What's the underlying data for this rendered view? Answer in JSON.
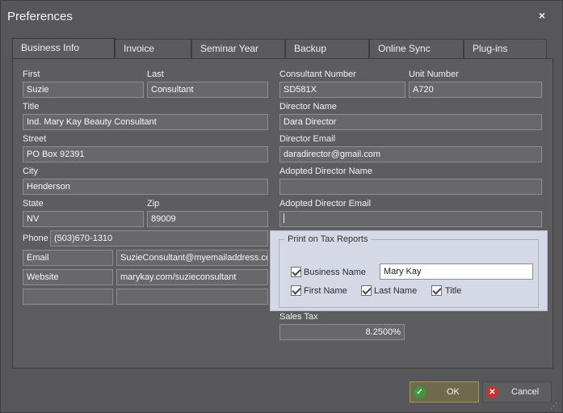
{
  "window": {
    "title": "Preferences",
    "close_label": "×"
  },
  "tabs": [
    {
      "label": "Business Info"
    },
    {
      "label": "Invoice"
    },
    {
      "label": "Seminar Year"
    },
    {
      "label": "Backup"
    },
    {
      "label": "Online Sync"
    },
    {
      "label": "Plug-ins"
    }
  ],
  "left": {
    "first_label": "First",
    "first_value": "Suzie",
    "last_label": "Last",
    "last_value": "Consultant",
    "title_label": "Title",
    "title_value": "Ind. Mary Kay Beauty Consultant",
    "street_label": "Street",
    "street_value": "PO Box 92391",
    "city_label": "City",
    "city_value": "Henderson",
    "state_label": "State",
    "state_value": "NV",
    "zip_label": "Zip",
    "zip_value": "89009",
    "phone_label": "Phone",
    "phone_value": "(503)670-1310",
    "custom": [
      {
        "type": "Email",
        "value": "SuzieConsultant@myemailaddress.com"
      },
      {
        "type": "Website",
        "value": "marykay.com/suzieconsultant"
      },
      {
        "type": "",
        "value": ""
      }
    ]
  },
  "right": {
    "consultant_number_label": "Consultant Number",
    "consultant_number_value": "SD581X",
    "unit_number_label": "Unit Number",
    "unit_number_value": "A720",
    "director_name_label": "Director Name",
    "director_name_value": "Dara Director",
    "director_email_label": "Director Email",
    "director_email_value": "daradirector@gmail.com",
    "adopted_director_name_label": "Adopted Director Name",
    "adopted_director_name_value": "",
    "adopted_director_email_label": "Adopted Director Email",
    "adopted_director_email_value": ""
  },
  "print_group": {
    "title": "Print on Tax Reports",
    "business_name_label": "Business Name",
    "business_name_checked": true,
    "business_name_value": "Mary Kay",
    "first_name_label": "First Name",
    "first_name_checked": true,
    "last_name_label": "Last Name",
    "last_name_checked": true,
    "title_label": "Title",
    "title_checked": true
  },
  "sales_tax": {
    "label": "Sales Tax",
    "value": "8.2500%"
  },
  "buttons": {
    "ok_label": "OK",
    "cancel_label": "Cancel"
  },
  "colors": {
    "ok_icon": "#3a9a3a",
    "cancel_icon": "#c4332f",
    "group_bg": "#d5d9e6"
  }
}
